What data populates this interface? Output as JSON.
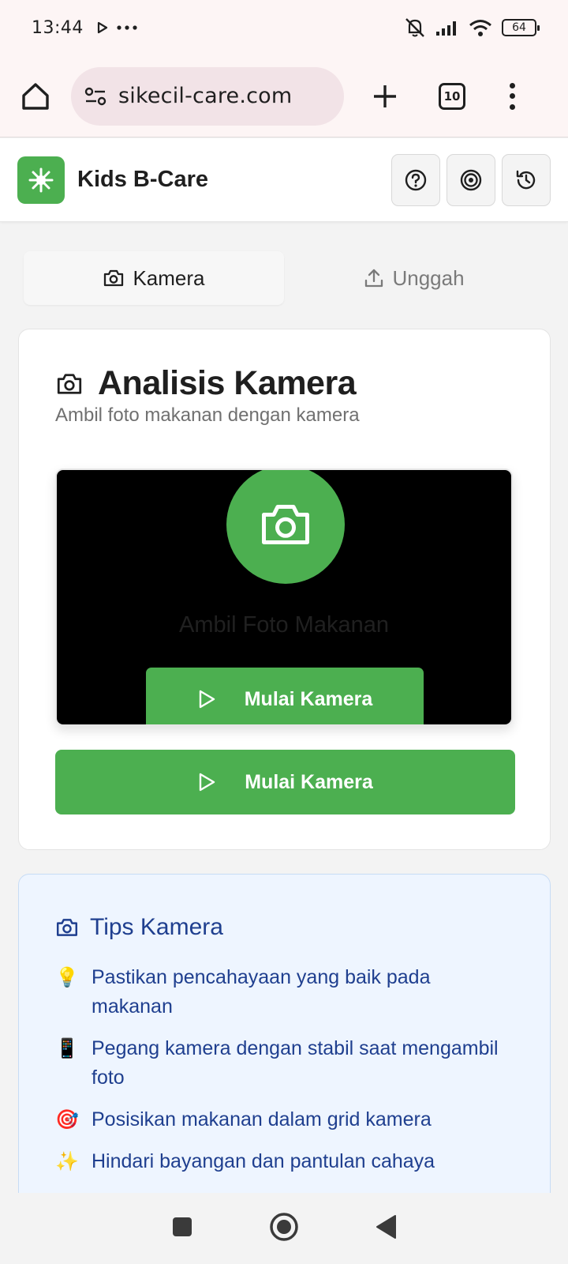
{
  "status_bar": {
    "time": "13:44",
    "battery": "64"
  },
  "browser": {
    "url": "sikecil-care.com",
    "tab_count": "10"
  },
  "app": {
    "title": "Kids B-Care"
  },
  "tabs": [
    {
      "label": "Kamera",
      "active": true
    },
    {
      "label": "Unggah",
      "active": false
    }
  ],
  "camera_card": {
    "title": "Analisis Kamera",
    "subtitle": "Ambil foto makanan dengan kamera",
    "viewer_text": "Ambil Foto Makanan",
    "viewer_button": "Mulai Kamera",
    "main_button": "Mulai Kamera"
  },
  "tips": {
    "title": "Tips Kamera",
    "items": [
      {
        "emoji": "💡",
        "text": "Pastikan pencahayaan yang baik pada makanan"
      },
      {
        "emoji": "📱",
        "text": "Pegang kamera dengan stabil saat mengambil foto"
      },
      {
        "emoji": "🎯",
        "text": "Posisikan makanan dalam grid kamera"
      },
      {
        "emoji": "✨",
        "text": "Hindari bayangan dan pantulan cahaya"
      }
    ]
  },
  "colors": {
    "accent": "#4caf50",
    "tips_bg": "#eef5ff",
    "tips_text": "#1f3f8f"
  }
}
